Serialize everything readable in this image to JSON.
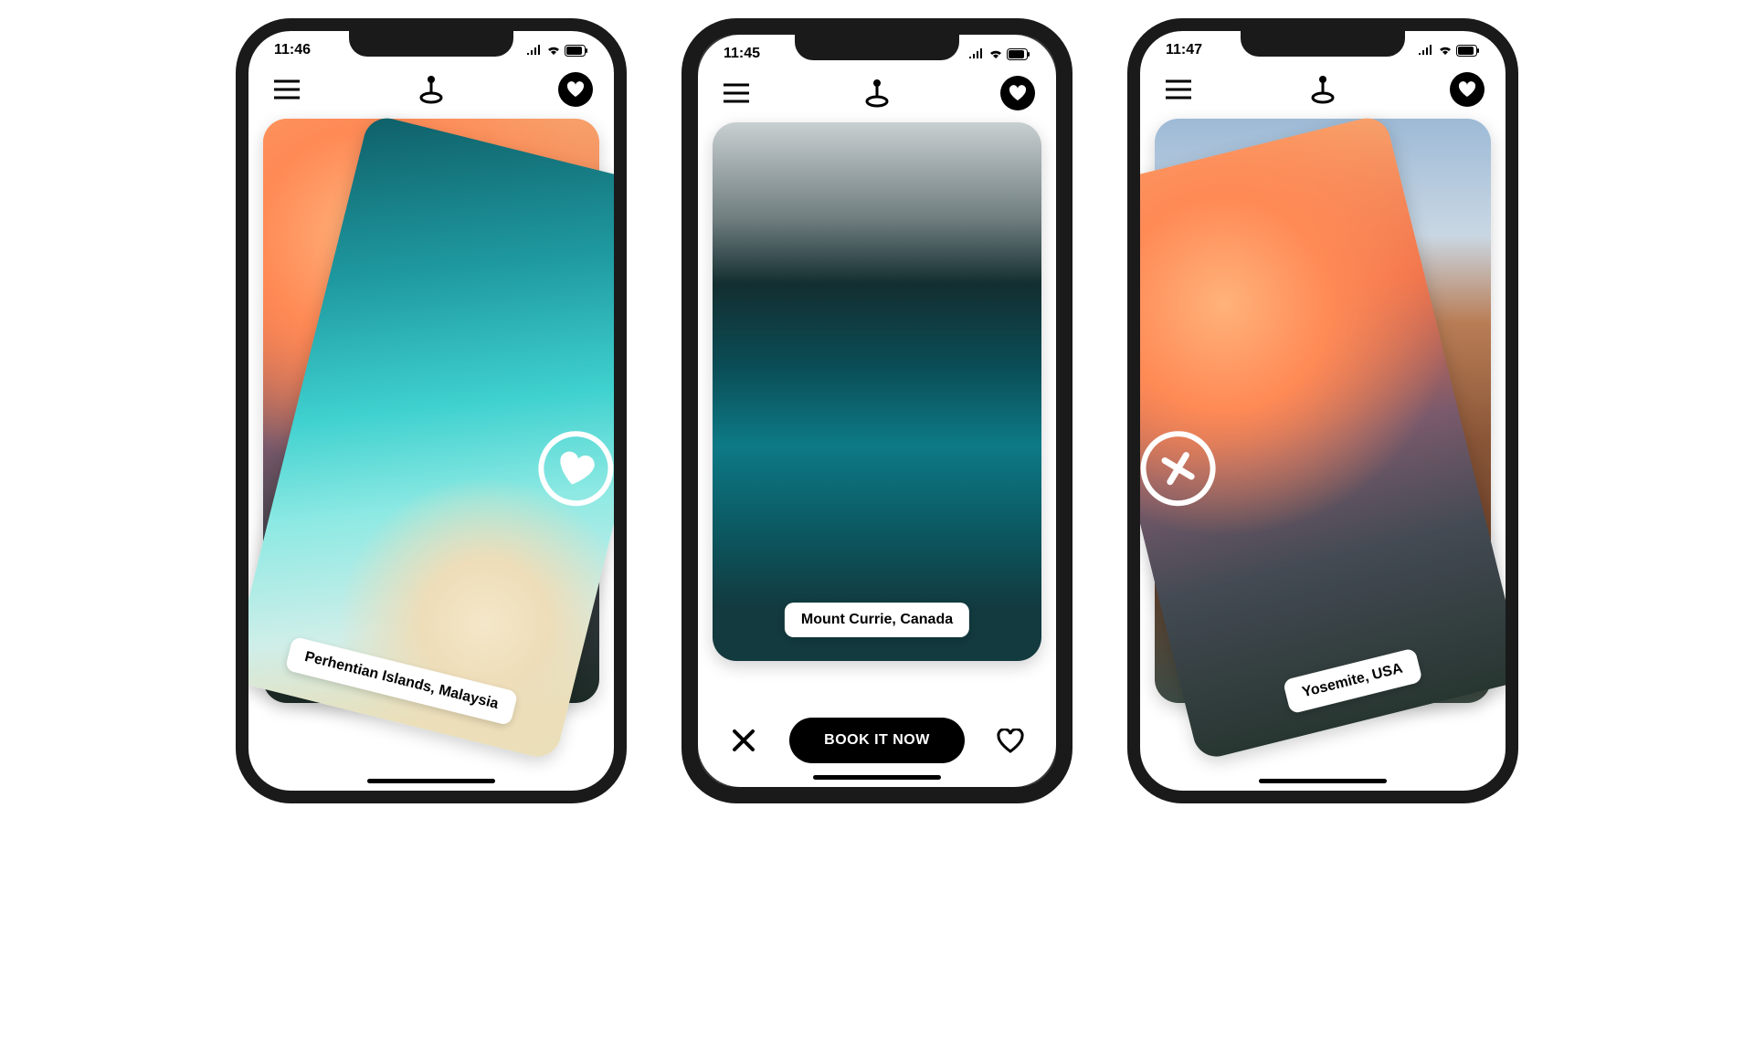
{
  "phones": [
    {
      "time": "11:46",
      "header": {
        "icons": [
          "menu",
          "location-pin",
          "heart-filled"
        ]
      },
      "behind_card": {
        "image": "sunset-mountains"
      },
      "front_card": {
        "image": "tropical-beach",
        "label": "Perhentian Islands, Malaysia",
        "swipe_badge": "heart",
        "tilt": "right"
      }
    },
    {
      "time": "11:45",
      "header": {
        "icons": [
          "menu",
          "location-pin",
          "heart-filled"
        ]
      },
      "card": {
        "image": "glacial-lake",
        "label": "Mount Currie, Canada"
      },
      "actions": {
        "dismiss_icon": "x",
        "primary_button": "BOOK IT NOW",
        "like_icon": "heart-outline"
      }
    },
    {
      "time": "11:47",
      "header": {
        "icons": [
          "menu",
          "location-pin",
          "heart-filled"
        ]
      },
      "behind_card": {
        "image": "venice-canal"
      },
      "front_card": {
        "image": "sunset-mountains",
        "label": "Yosemite, USA",
        "swipe_badge": "x",
        "tilt": "left"
      }
    }
  ]
}
